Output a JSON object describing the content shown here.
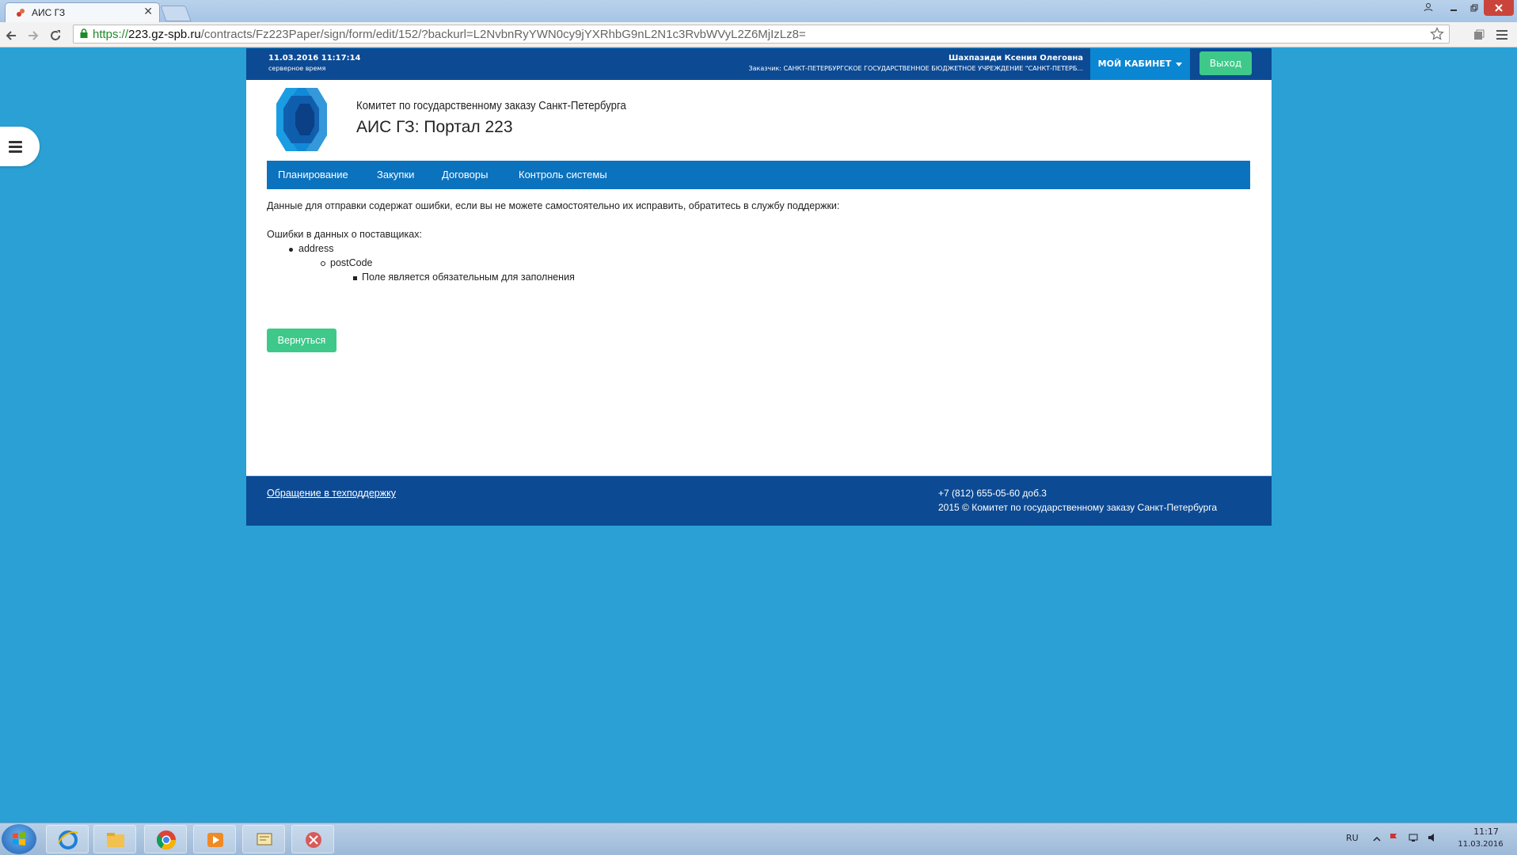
{
  "browser": {
    "tab_title": "АИС ГЗ",
    "close_glyph": "✕",
    "url_scheme": "https://",
    "url_domain": "223.gz-spb.ru",
    "url_path": "/contracts/Fz223Paper/sign/form/edit/152/?backurl=L2NvbnRyYWN0cy9jYXRhbG9nL2N1c3RvbWVyL2Z6MjIzLz8="
  },
  "header": {
    "datetime": "11.03.2016 11:17:14",
    "server_time_label": "серверное время",
    "user_name": "Шахпазиди Ксения Олеговна",
    "customer": "Заказчик: САНКТ-ПЕТЕРБУРГСКОЕ ГОСУДАРСТВЕННОЕ БЮДЖЕТНОЕ УЧРЕЖДЕНИЕ \"САНКТ-ПЕТЕРБ...",
    "cabinet_label": "МОЙ КАБИНЕТ",
    "logout_label": "Выход"
  },
  "branding": {
    "org_name": "Комитет по государственному заказу Санкт-Петербурга",
    "portal_title": "АИС ГЗ: Портал 223"
  },
  "nav": {
    "items": [
      {
        "label": "Планирование"
      },
      {
        "label": "Закупки"
      },
      {
        "label": "Договоры"
      },
      {
        "label": "Контроль системы"
      }
    ]
  },
  "content": {
    "intro": "Данные для отправки содержат ошибки, если вы не можете самостоятельно их исправить, обратитесь в службу поддержки:",
    "errors_heading": "Ошибки в данных о поставщиках:",
    "error_field": "address",
    "error_subfield": "postCode",
    "error_message": "Поле является обязательным для заполнения",
    "back_label": "Вернуться"
  },
  "footer": {
    "support_link": "Обращение в техподдержку",
    "phone": "+7 (812) 655-05-60 доб.3",
    "copyright": "2015 © Комитет по государственному заказу Санкт-Петербурга"
  },
  "taskbar": {
    "lang": "RU",
    "time": "11:17",
    "date": "11.03.2016"
  },
  "colors": {
    "page_bg": "#2aa0d5",
    "header_bg": "#0c4a94",
    "nav_bg": "#0b72be",
    "accent_green": "#3ec98a",
    "cabinet_bg": "#0b86d2"
  }
}
